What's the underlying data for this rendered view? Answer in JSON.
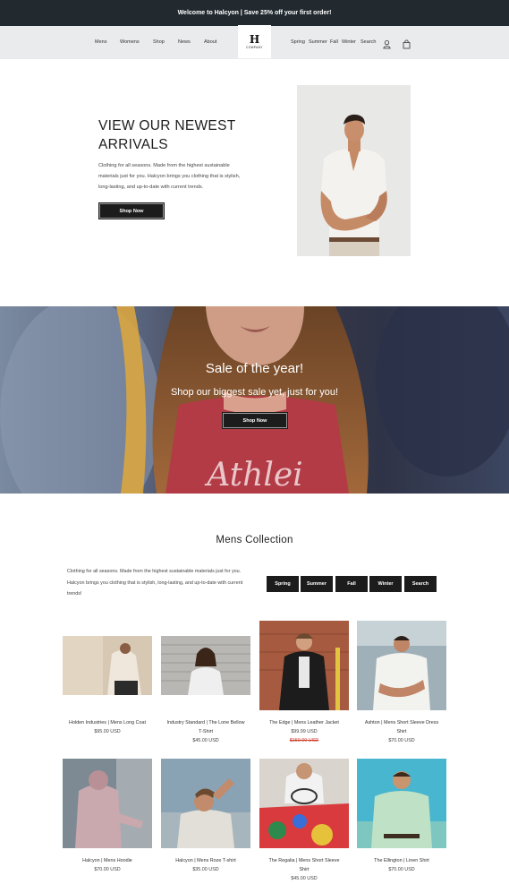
{
  "announcement": "Welcome to Halcyon | Save 25% off your first order!",
  "nav_left": [
    "Mens",
    "Womens",
    "Shop",
    "News",
    "About"
  ],
  "logo": {
    "letter": "H",
    "sub": "COMPANY"
  },
  "nav_right": [
    "Spring",
    "Summer",
    "Fall",
    "Winter",
    "Search"
  ],
  "icons": {
    "account": "user-icon",
    "cart": "bag-icon"
  },
  "hero": {
    "title_line1": "VIEW OUR NEWEST",
    "title_line2": "ARRIVALS",
    "text": "Clothing for all seasons. Made from the highest sustainable materials just for you. Halcyon brings you clothing that is stylish, long-lasting, and up-to-date with current trends.",
    "button": "Shop Now"
  },
  "sale": {
    "title": "Sale of the year!",
    "subtitle": "Shop our biggest sale yet, just for you!",
    "button": "Shop Now",
    "shirt_print": "Athlei"
  },
  "collection": {
    "title": "Mens Collection",
    "text": "Clothing for all seasons. Made from the highest sustainable materials just for you. Halcyon brings you clothing that is stylish, long-lasting, and up-to-date with current trends!",
    "filters": [
      "Spring",
      "Summer",
      "Fall",
      "Winter",
      "Search"
    ]
  },
  "products": [
    {
      "name_l1": "Holden Industries | Mens Long Coat",
      "name_l2": "",
      "price": "$95.00 USD",
      "old_price": ""
    },
    {
      "name_l1": "Industry Standard | The Lone Bellow",
      "name_l2": "T-Shirt",
      "price": "$45.00 USD",
      "old_price": ""
    },
    {
      "name_l1": "The Edge | Mens Leather Jacket",
      "name_l2": "",
      "price": "$99.99 USD",
      "old_price": "$150.00 USD"
    },
    {
      "name_l1": "Ashton | Mens Short Sleeve Dress",
      "name_l2": "Shirt",
      "price": "$70.00 USD",
      "old_price": ""
    },
    {
      "name_l1": "Halcyon | Mens Hoodie",
      "name_l2": "",
      "price": "$70.00 USD",
      "old_price": ""
    },
    {
      "name_l1": "Halcyon | Mens Roze T-shirt",
      "name_l2": "",
      "price": "$35.00 USD",
      "old_price": ""
    },
    {
      "name_l1": "The Regalia | Mens Short Sleeve",
      "name_l2": "Shirt",
      "price": "$45.00 USD",
      "old_price": ""
    },
    {
      "name_l1": "The Ellington | Linen Shirt",
      "name_l2": "",
      "price": "$70.00 USD",
      "old_price": ""
    }
  ]
}
